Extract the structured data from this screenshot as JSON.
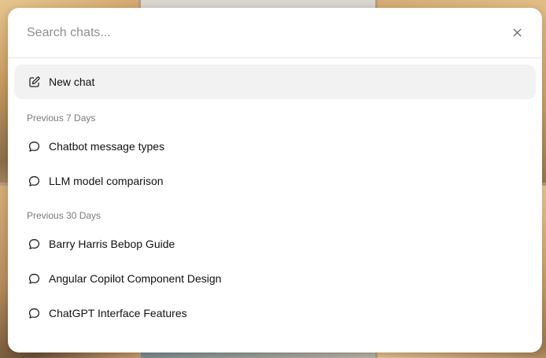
{
  "search": {
    "placeholder": "Search chats...",
    "value": ""
  },
  "close_icon": "close-icon",
  "new_chat": {
    "label": "New chat",
    "icon": "edit-icon"
  },
  "sections": [
    {
      "header": "Previous 7 Days",
      "items": [
        {
          "label": "Chatbot message types",
          "icon": "chat-bubble-icon"
        },
        {
          "label": "LLM model comparison",
          "icon": "chat-bubble-icon"
        }
      ]
    },
    {
      "header": "Previous 30 Days",
      "items": [
        {
          "label": "Barry Harris Bebop Guide",
          "icon": "chat-bubble-icon"
        },
        {
          "label": "Angular Copilot Component Design",
          "icon": "chat-bubble-icon"
        },
        {
          "label": "ChatGPT Interface Features",
          "icon": "chat-bubble-icon"
        }
      ]
    }
  ],
  "colors": {
    "modal_bg": "#ffffff",
    "new_chat_bg": "#f2f2f2",
    "section_header": "#7a7a7a",
    "text": "#111111"
  }
}
